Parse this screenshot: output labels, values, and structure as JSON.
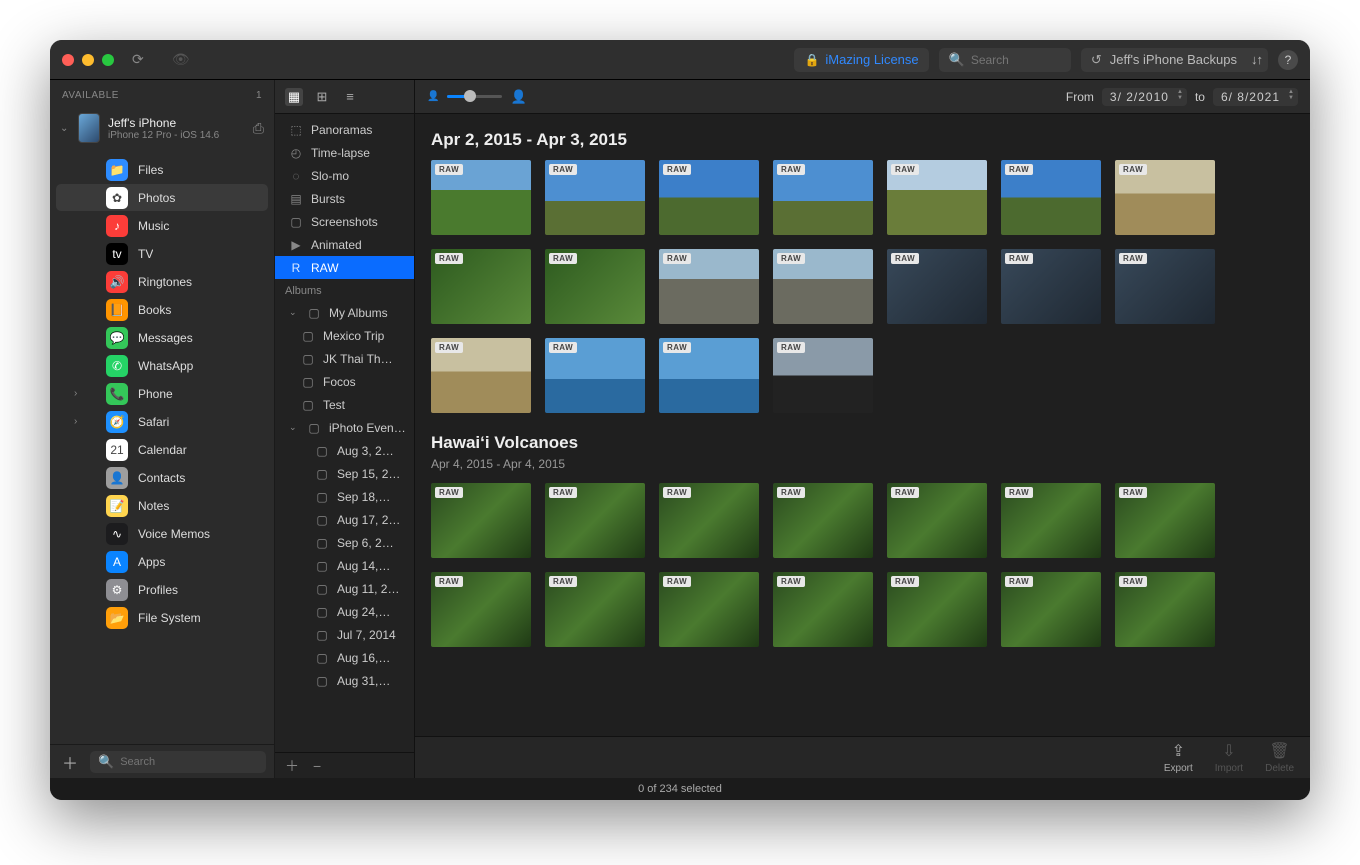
{
  "titlebar": {
    "license_label": "iMazing License",
    "search_placeholder": "Search",
    "backups_label": "Jeff's iPhone Backups"
  },
  "sidebar": {
    "header": "AVAILABLE",
    "count": "1",
    "device": {
      "name": "Jeff's iPhone",
      "subtitle": "iPhone 12 Pro - iOS 14.6"
    },
    "apps": [
      {
        "label": "Files",
        "color": "#2d8cff",
        "glyph": "📁",
        "expandable": false
      },
      {
        "label": "Photos",
        "color": "#fff",
        "glyph": "✿",
        "selected": true
      },
      {
        "label": "Music",
        "color": "#fc3d39",
        "glyph": "♪"
      },
      {
        "label": "TV",
        "color": "#000",
        "glyph": "tv"
      },
      {
        "label": "Ringtones",
        "color": "#fc3d39",
        "glyph": "🔊"
      },
      {
        "label": "Books",
        "color": "#ff9500",
        "glyph": "📙"
      },
      {
        "label": "Messages",
        "color": "#34c759",
        "glyph": "💬"
      },
      {
        "label": "WhatsApp",
        "color": "#25d366",
        "glyph": "✆"
      },
      {
        "label": "Phone",
        "color": "#34c759",
        "glyph": "📞",
        "expandable": true
      },
      {
        "label": "Safari",
        "color": "#1e90ff",
        "glyph": "🧭",
        "expandable": true
      },
      {
        "label": "Calendar",
        "color": "#fff",
        "glyph": "21"
      },
      {
        "label": "Contacts",
        "color": "#9e9e9e",
        "glyph": "👤"
      },
      {
        "label": "Notes",
        "color": "#ffd54f",
        "glyph": "📝"
      },
      {
        "label": "Voice Memos",
        "color": "#1c1c1e",
        "glyph": "∿"
      },
      {
        "label": "Apps",
        "color": "#0a84ff",
        "glyph": "A"
      },
      {
        "label": "Profiles",
        "color": "#8e8e93",
        "glyph": "⚙"
      },
      {
        "label": "File System",
        "color": "#ff9f0a",
        "glyph": "📂"
      }
    ],
    "search_placeholder": "Search"
  },
  "midbar": {
    "smart": [
      {
        "label": "Panoramas",
        "icon": "⬚"
      },
      {
        "label": "Time-lapse",
        "icon": "◴"
      },
      {
        "label": "Slo-mo",
        "icon": "◌"
      },
      {
        "label": "Bursts",
        "icon": "▤"
      },
      {
        "label": "Screenshots",
        "icon": "▢"
      },
      {
        "label": "Animated",
        "icon": "▶"
      },
      {
        "label": "RAW",
        "icon": "R",
        "selected": true
      }
    ],
    "albums_header": "Albums",
    "my_albums": "My Albums",
    "my_albums_items": [
      "Mexico Trip",
      "JK Thai Th…",
      "Focos",
      "Test"
    ],
    "iphoto": "iPhoto Even…",
    "iphoto_items": [
      "Aug 3, 2…",
      "Sep 15, 2…",
      "Sep 18,…",
      "Aug 17, 2…",
      "Sep 6, 2…",
      "Aug 14,…",
      "Aug 11, 2…",
      "Aug 24,…",
      "Jul 7, 2014",
      "Aug 16,…",
      "Aug 31,…"
    ]
  },
  "main": {
    "date_from_label": "From",
    "date_from": "3/  2/2010",
    "date_to_label": "to",
    "date_to": "6/  8/2021",
    "sections": [
      {
        "title": "Apr 2, 2015 - Apr 3, 2015",
        "subtitle": "",
        "thumbs": [
          {
            "v": "g1",
            "b": "RAW"
          },
          {
            "v": "g2",
            "b": "RAW"
          },
          {
            "v": "g3",
            "b": "RAW"
          },
          {
            "v": "g2",
            "b": "RAW"
          },
          {
            "v": "g4",
            "b": "RAW"
          },
          {
            "v": "g3",
            "b": "RAW"
          },
          {
            "v": "dry",
            "b": "RAW"
          },
          {
            "v": "leaf",
            "b": "RAW"
          },
          {
            "v": "leaf",
            "b": "RAW"
          },
          {
            "v": "road",
            "b": "RAW"
          },
          {
            "v": "road",
            "b": "RAW"
          },
          {
            "v": "mirror",
            "b": "RAW"
          },
          {
            "v": "mirror",
            "b": "RAW"
          },
          {
            "v": "mirror",
            "b": "RAW"
          },
          {
            "v": "dry",
            "b": "RAW"
          },
          {
            "v": "sea",
            "b": "RAW"
          },
          {
            "v": "sea",
            "b": "RAW"
          },
          {
            "v": "beach",
            "b": "RAW"
          }
        ]
      },
      {
        "title": "Hawai‘i Volcanoes",
        "subtitle": "Apr 4, 2015 - Apr 4, 2015",
        "thumbs": [
          {
            "v": "jungle",
            "b": "RAW"
          },
          {
            "v": "jungle",
            "b": "RAW"
          },
          {
            "v": "jungle",
            "b": "RAW"
          },
          {
            "v": "jungle",
            "b": "RAW"
          },
          {
            "v": "jungle",
            "b": "RAW"
          },
          {
            "v": "jungle",
            "b": "RAW"
          },
          {
            "v": "jungle",
            "b": "RAW"
          },
          {
            "v": "jungle",
            "b": "RAW"
          },
          {
            "v": "jungle",
            "b": "RAW"
          },
          {
            "v": "jungle",
            "b": "RAW"
          },
          {
            "v": "jungle",
            "b": "RAW"
          },
          {
            "v": "jungle",
            "b": "RAW"
          },
          {
            "v": "jungle",
            "b": "RAW"
          },
          {
            "v": "jungle",
            "b": "RAW"
          }
        ]
      }
    ],
    "footer": {
      "export": "Export",
      "import": "Import",
      "delete": "Delete"
    }
  },
  "statusbar": "0 of 234 selected"
}
